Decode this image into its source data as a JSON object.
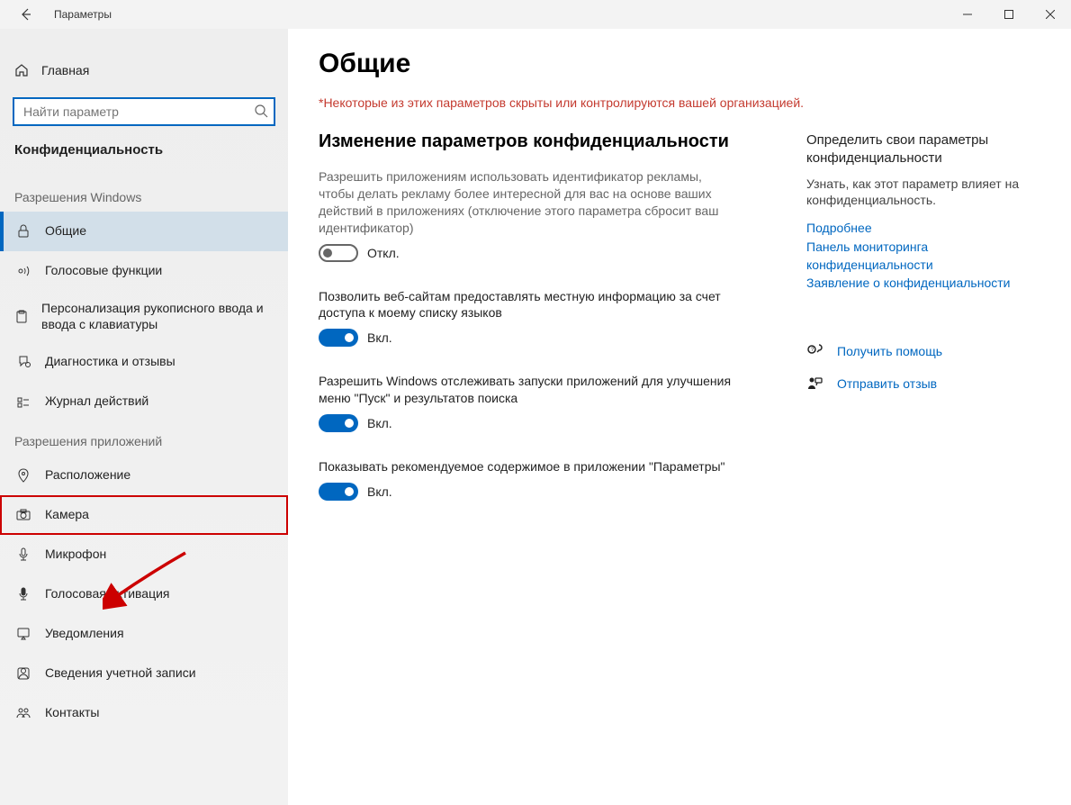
{
  "titlebar": {
    "title": "Параметры"
  },
  "sidebar": {
    "home": "Главная",
    "search_placeholder": "Найти параметр",
    "section": "Конфиденциальность",
    "group_windows": "Разрешения Windows",
    "group_apps": "Разрешения приложений",
    "win_items": [
      "Общие",
      "Голосовые функции",
      "Персонализация рукописного ввода и ввода с клавиатуры",
      "Диагностика и отзывы",
      "Журнал действий"
    ],
    "app_items": [
      "Расположение",
      "Камера",
      "Микрофон",
      "Голосовая активация",
      "Уведомления",
      "Сведения учетной записи",
      "Контакты"
    ]
  },
  "content": {
    "title": "Общие",
    "org_notice": "*Некоторые из этих параметров скрыты или контролируются вашей организацией.",
    "sub_heading": "Изменение параметров конфиденциальности",
    "settings": [
      {
        "desc": "Разрешить приложениям использовать идентификатор рекламы, чтобы делать рекламу более интересной для вас на основе ваших действий в приложениях (отключение этого параметра сбросит ваш идентификатор)",
        "state": "Откл.",
        "on": false,
        "muted": true
      },
      {
        "desc": "Позволить веб-сайтам предоставлять местную информацию за счет доступа к моему списку языков",
        "state": "Вкл.",
        "on": true,
        "muted": false
      },
      {
        "desc": "Разрешить Windows отслеживать запуски приложений для улучшения меню \"Пуск\" и результатов поиска",
        "state": "Вкл.",
        "on": true,
        "muted": false
      },
      {
        "desc": "Показывать рекомендуемое содержимое в приложении \"Параметры\"",
        "state": "Вкл.",
        "on": true,
        "muted": false
      }
    ]
  },
  "aside": {
    "title": "Определить свои параметры конфиденциальности",
    "text": "Узнать, как этот параметр влияет на конфиденциальность.",
    "links": [
      "Подробнее",
      "Панель мониторинга конфиденциальности",
      "Заявление о конфиденциальности"
    ],
    "help": "Получить помощь",
    "feedback": "Отправить отзыв"
  }
}
